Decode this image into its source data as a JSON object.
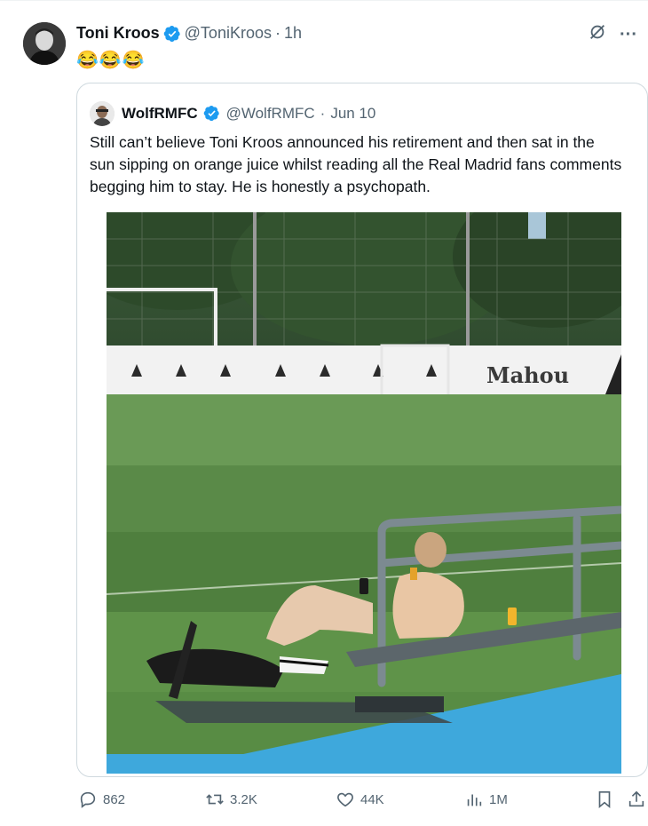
{
  "tweet": {
    "author_name": "Toni Kroos",
    "author_handle": "@ToniKroos",
    "separator": "·",
    "time": "1h",
    "text": "😂😂😂"
  },
  "top_icons": {
    "grok": "grok-icon",
    "more": "more-icon",
    "more_glyph": "···"
  },
  "quoted": {
    "author_name": "WolfRMFC",
    "author_handle": "@WolfRMFC",
    "separator": "·",
    "date": "Jun 10",
    "text": "Still can’t believe Toni Kroos announced his retirement and then sat in the sun sipping on orange juice whilst reading all the Real Madrid fans comments begging him to stay. He is honestly a psychopath.",
    "media": {
      "banner_text": "Mahou"
    }
  },
  "actions": {
    "replies": "862",
    "reposts": "3.2K",
    "likes": "44K",
    "views": "1M"
  },
  "colors": {
    "verified": "#1d9bf0",
    "secondary_text": "#536471",
    "border": "#cfd9de"
  }
}
